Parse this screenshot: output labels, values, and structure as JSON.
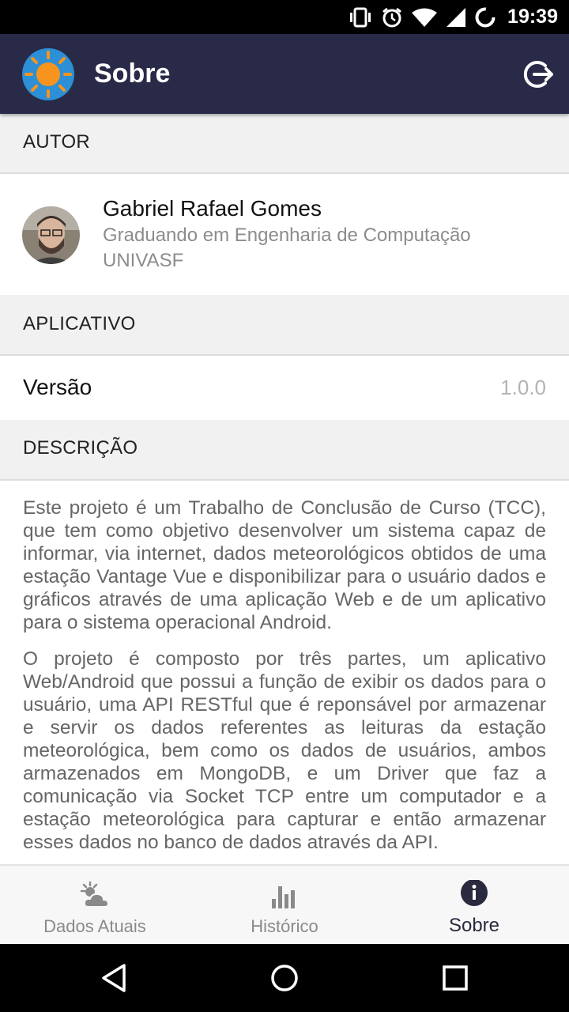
{
  "status_bar": {
    "time": "19:39",
    "icons": [
      "vibrate-icon",
      "alarm-icon",
      "wifi-icon",
      "signal-icon",
      "battery-loading-icon"
    ]
  },
  "app_bar": {
    "title": "Sobre",
    "logo_icon": "sun-icon",
    "action_icon": "logout-icon"
  },
  "sections": {
    "author_header": "AUTOR",
    "app_header": "APLICATIVO",
    "description_header": "DESCRIÇÃO"
  },
  "author": {
    "name": "Gabriel Rafael Gomes",
    "description": "Graduando em Engenharia de Computação",
    "institution": "UNIVASF"
  },
  "app_info": {
    "version_label": "Versão",
    "version_value": "1.0.0"
  },
  "description": {
    "paragraph_1": "Este projeto é um Trabalho de Conclusão de Curso (TCC), que tem como objetivo desenvolver um sistema capaz de informar, via internet, dados meteorológicos obtidos de uma estação Vantage Vue e disponibilizar para o usuário dados e gráficos através de uma aplicação Web e de um aplicativo para o sistema operacional Android.",
    "paragraph_2": "O projeto é composto por três partes, um aplicativo Web/Android que possui a função de exibir os dados para o usuário, uma API RESTful que é reponsável por armazenar e servir os dados referentes as leituras da estação meteorológica, bem como os dados de usuários, ambos armazenados em MongoDB, e um Driver que faz a comunicação via Socket TCP entre um computador e a estação meteorológica para capturar e então armazenar esses dados no banco de dados através da API."
  },
  "bottom_nav": {
    "items": [
      {
        "label": "Dados Atuais",
        "icon": "partly-cloudy-icon",
        "active": false
      },
      {
        "label": "Histórico",
        "icon": "bar-chart-icon",
        "active": false
      },
      {
        "label": "Sobre",
        "icon": "info-icon",
        "active": true
      }
    ]
  },
  "colors": {
    "app_bar": "#282a47",
    "logo_background": "#2d8fd6",
    "logo_sun": "#f7941d",
    "active_nav": "#2a2a3e"
  }
}
